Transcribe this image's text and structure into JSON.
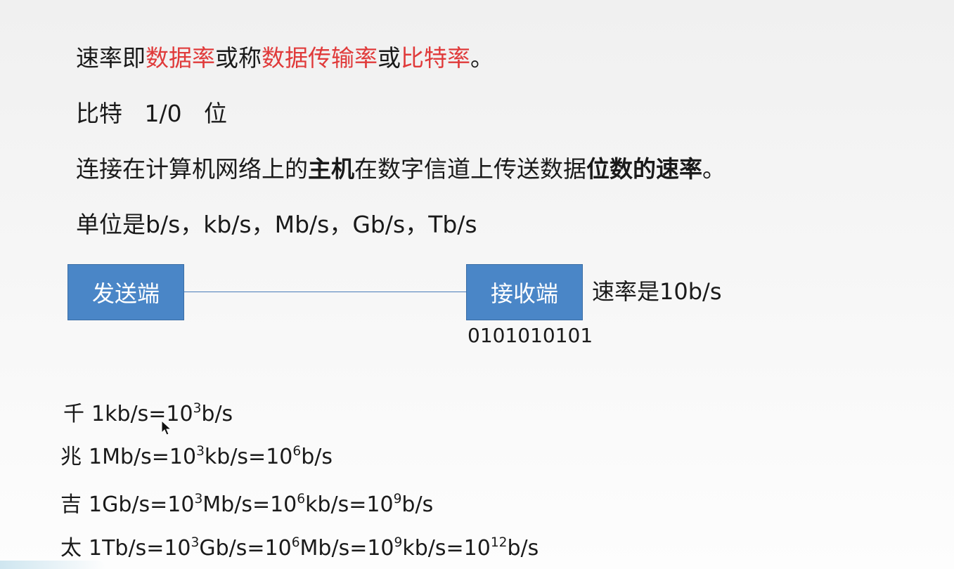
{
  "line1": {
    "p1": "速率即",
    "r1": "数据率",
    "p2": "或称",
    "r2": "数据传输率",
    "p3": "或",
    "r3": "比特率",
    "p4": "。"
  },
  "line2": {
    "text": "比特   1/0   位"
  },
  "line3": {
    "p1": "连接在计算机网络上的",
    "b1": "主机",
    "p2": "在数字信道上传送数据",
    "b2": "位数的速率",
    "p3": "。"
  },
  "line4": {
    "text": "单位是b/s，kb/s，Mb/s，Gb/s，Tb/s"
  },
  "diagram": {
    "sender": "发送端",
    "receiver": "接收端",
    "rate_note": "速率是10b/s",
    "bits": "0101010101"
  },
  "formulas": {
    "kilo": {
      "prefix": "千",
      "a": "1kb/s=10",
      "e1": "3",
      "b": "b/s"
    },
    "mega": {
      "prefix": "兆",
      "a": "1Mb/s=10",
      "e1": "3",
      "b": "kb/s=10",
      "e2": "6",
      "c": "b/s"
    },
    "giga": {
      "prefix": "吉",
      "a": "1Gb/s=10",
      "e1": "3",
      "b": "Mb/s=10",
      "e2": "6",
      "c": "kb/s=10",
      "e3": "9",
      "d": "b/s"
    },
    "tera": {
      "prefix": "太",
      "a": "1Tb/s=10",
      "e1": "3",
      "b": "Gb/s=10",
      "e2": "6",
      "c": "Mb/s=10",
      "e3": "9",
      "d": "kb/s=10",
      "e4": "12",
      "e": "b/s"
    }
  },
  "colors": {
    "highlight": "#e03a3a",
    "box_fill": "#4a86c7",
    "box_text": "#ffffff"
  }
}
